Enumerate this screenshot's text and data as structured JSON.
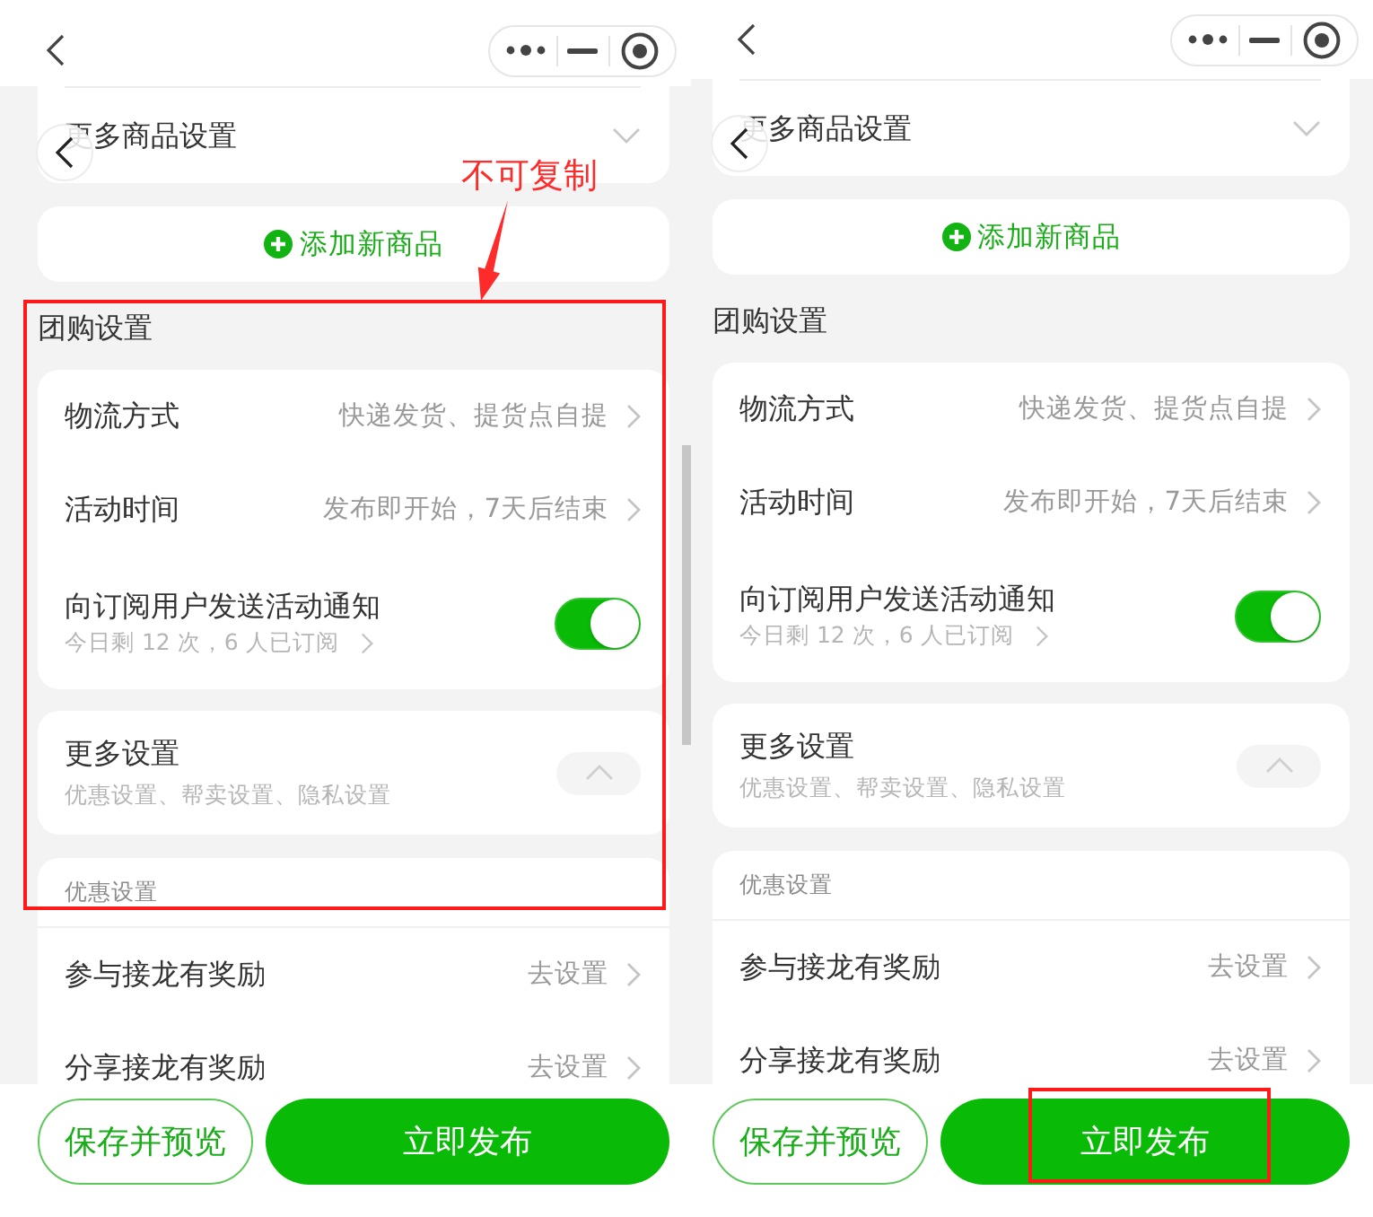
{
  "screens": [
    {
      "product_more": {
        "title": "更多商品设置",
        "expanded": false
      },
      "add_product": {
        "label": "添加新商品"
      },
      "group_buy": {
        "title": "团购设置",
        "rows": [
          {
            "kind": "link",
            "label": "物流方式",
            "value": "快递发货、提货点自提"
          },
          {
            "kind": "link",
            "label": "活动时间",
            "value": "发布即开始，7天后结束"
          },
          {
            "kind": "switch",
            "label": "向订阅用户发送活动通知",
            "note": "今日剩 12 次，6 人已订阅",
            "on": true
          }
        ]
      },
      "more_settings": {
        "title": "更多设置",
        "summary": "优惠设置、帮卖设置、隐私设置",
        "expanded": true
      },
      "discount": {
        "title": "优惠设置",
        "rows": [
          {
            "kind": "link",
            "label": "参与接龙有奖励",
            "value": "去设置"
          },
          {
            "kind": "link",
            "label": "分享接龙有奖励",
            "value": "去设置"
          }
        ]
      },
      "actions": [
        {
          "kind": "outline",
          "label": "保存并预览"
        },
        {
          "kind": "primary",
          "label": "立即发布"
        }
      ],
      "annotations": [
        {
          "kind": "section-frame"
        },
        {
          "kind": "callout",
          "text": "不可复制"
        }
      ]
    },
    {
      "product_more": {
        "title": "更多商品设置",
        "expanded": false
      },
      "add_product": {
        "label": "添加新商品"
      },
      "group_buy": {
        "title": "团购设置",
        "rows": [
          {
            "kind": "link",
            "label": "物流方式",
            "value": "快递发货、提货点自提"
          },
          {
            "kind": "link",
            "label": "活动时间",
            "value": "发布即开始，7天后结束"
          },
          {
            "kind": "switch",
            "label": "向订阅用户发送活动通知",
            "note": "今日剩 12 次，6 人已订阅",
            "on": true
          }
        ]
      },
      "more_settings": {
        "title": "更多设置",
        "summary": "优惠设置、帮卖设置、隐私设置",
        "expanded": true
      },
      "discount": {
        "title": "优惠设置",
        "rows": [
          {
            "kind": "link",
            "label": "参与接龙有奖励",
            "value": "去设置"
          },
          {
            "kind": "link",
            "label": "分享接龙有奖励",
            "value": "去设置"
          }
        ]
      },
      "actions": [
        {
          "kind": "outline",
          "label": "保存并预览"
        },
        {
          "kind": "primary",
          "label": "立即发布"
        }
      ],
      "annotations": [
        {
          "kind": "button-frame"
        }
      ]
    }
  ]
}
